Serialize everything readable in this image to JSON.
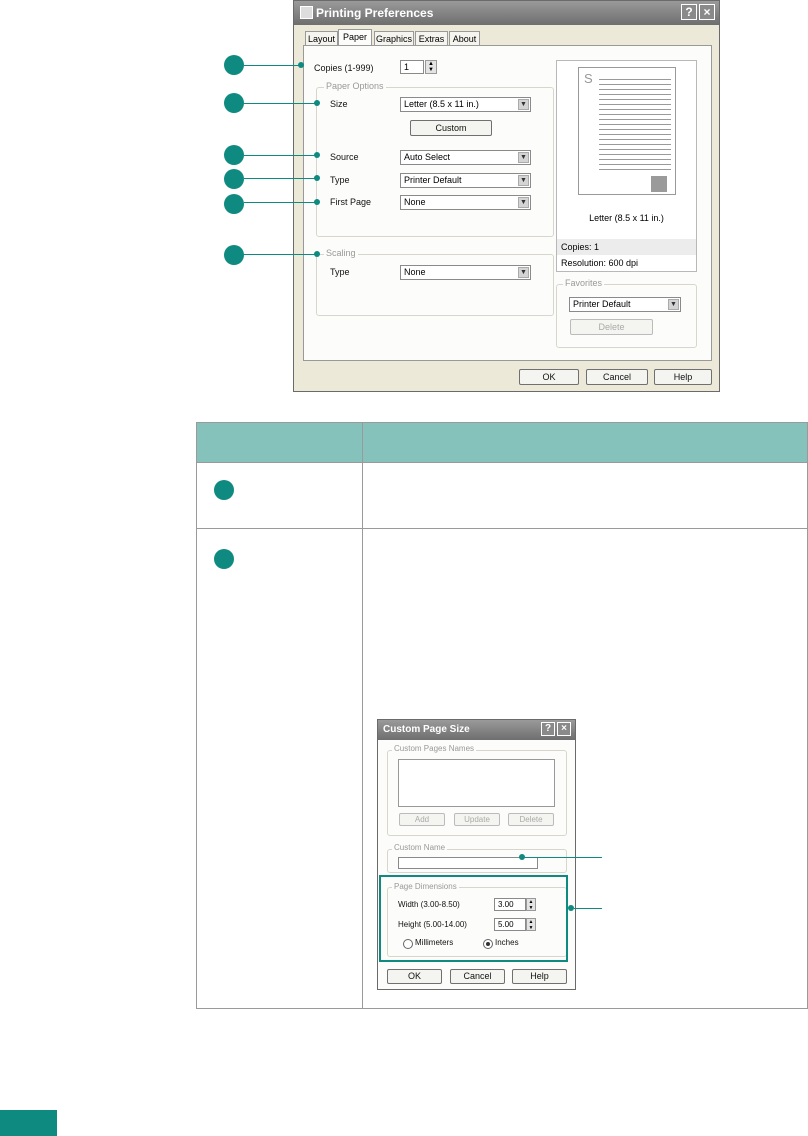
{
  "dialog": {
    "title": "Printing Preferences",
    "help_btn": "?",
    "close_btn": "×",
    "tabs": [
      "Layout",
      "Paper",
      "Graphics",
      "Extras",
      "About"
    ],
    "copies_label": "Copies (1-999)",
    "copies_value": "1",
    "paper_options_label": "Paper Options",
    "size_label": "Size",
    "size_value": "Letter (8.5 x 11 in.)",
    "custom_button": "Custom",
    "source_label": "Source",
    "source_value": "Auto Select",
    "type_label": "Type",
    "type_value": "Printer Default",
    "first_page_label": "First Page",
    "first_page_value": "None",
    "scaling_label": "Scaling",
    "scaling_type_label": "Type",
    "scaling_type_value": "None",
    "preview_letter": "S",
    "preview_caption": "Letter (8.5 x 11 in.)",
    "copies_info": "Copies: 1",
    "resolution_info": "Resolution: 600 dpi",
    "favorites_label": "Favorites",
    "favorites_value": "Printer Default",
    "delete_button": "Delete",
    "ok_button": "OK",
    "cancel_button": "Cancel",
    "help_button": "Help"
  },
  "custom_dialog": {
    "title": "Custom Page Size",
    "help_btn": "?",
    "close_btn": "×",
    "custom_pages_names_label": "Custom Pages Names",
    "add_button": "Add",
    "update_button": "Update",
    "delete_button": "Delete",
    "custom_name_label": "Custom Name",
    "page_dimensions_label": "Page Dimensions",
    "width_label": "Width (3.00-8.50)",
    "width_value": "3.00",
    "height_label": "Height (5.00-14.00)",
    "height_value": "5.00",
    "millimeters_label": "Millimeters",
    "inches_label": "Inches",
    "ok_button": "OK",
    "cancel_button": "Cancel",
    "help_button": "Help"
  },
  "colors": {
    "accent": "#0e8a80",
    "table_header": "#86c2bc",
    "footer_bar": "#0e8a80"
  }
}
